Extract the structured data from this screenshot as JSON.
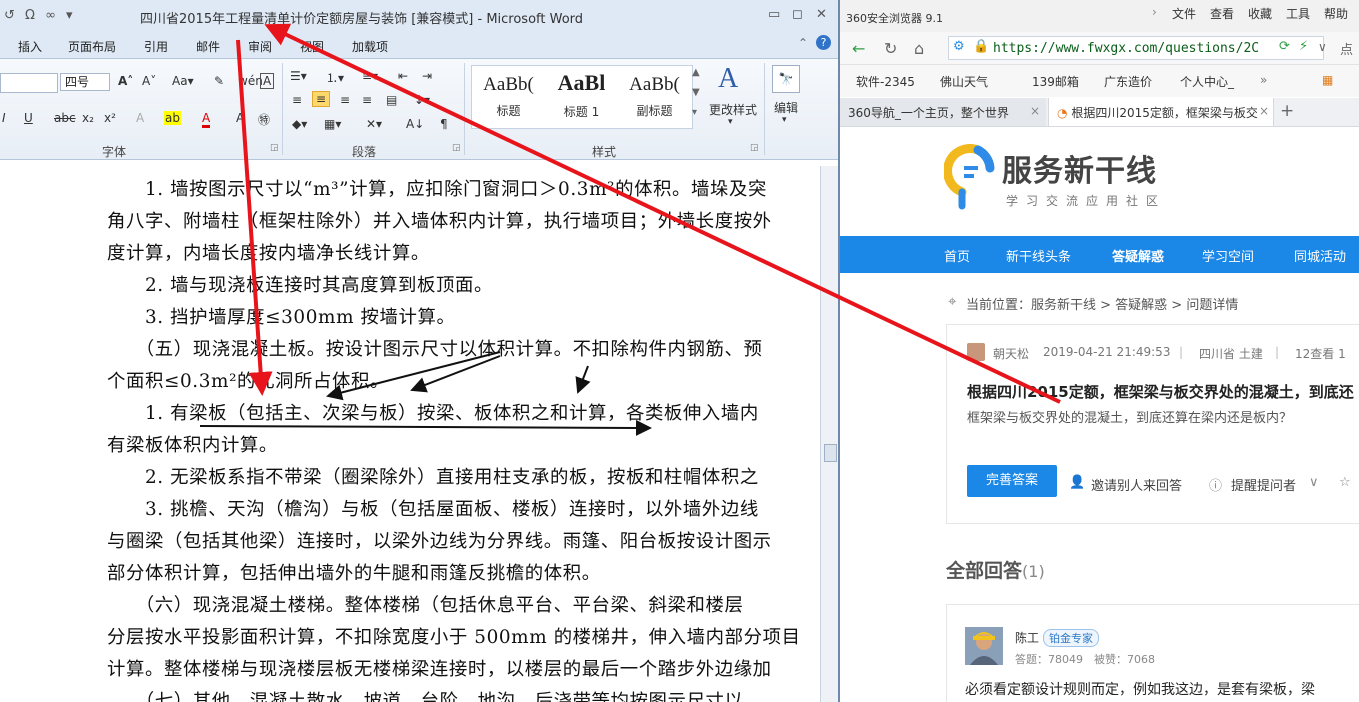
{
  "word": {
    "quick_access": "↺ Ω ∞ ▾",
    "title": "四川省2015年工程量清单计价定额房屋与装饰 [兼容模式] - Microsoft Word",
    "window_controls": {
      "minimize": "▭",
      "restore": "◻",
      "close": "✕"
    },
    "tabs": [
      "插入",
      "页面布局",
      "引用",
      "邮件",
      "审阅",
      "视图",
      "加载项"
    ],
    "font_size": "四号",
    "groups": {
      "font": "字体",
      "paragraph": "段落",
      "styles": "样式"
    },
    "styles": [
      {
        "preview": "AaBb(",
        "name": "标题"
      },
      {
        "preview": "AaBl",
        "name": "标题 1"
      },
      {
        "preview": "AaBb(",
        "name": "副标题"
      }
    ],
    "change_styles": "更改样式",
    "edit": "编辑",
    "document_lines": [
      "　　1. 墙按图示尺寸以“m³”计算，应扣除门窗洞口＞0.3m²的体积。墙垛及突",
      "角八字、附墙柱（框架柱除外）并入墙体积内计算，执行墙项目；外墙长度按外",
      "度计算，内墙长度按内墙净长线计算。",
      "　　2. 墙与现浇板连接时其高度算到板顶面。",
      "　　3. 挡护墙厚度≤300mm 按墙计算。",
      "　　（五）现浇混凝土板。按设计图示尺寸以体积计算。不扣除构件内钢筋、预",
      "个面积≤0.3m²的孔洞所占体积。",
      "　　1. 有梁板（包括主、次梁与板）按梁、板体积之和计算，各类板伸入墙内",
      "有梁板体积内计算。",
      "　　2. 无梁板系指不带梁（圈梁除外）直接用柱支承的板，按板和柱帽体积之",
      "　　3. 挑檐、天沟（檐沟）与板（包括屋面板、楼板）连接时，以外墙外边线",
      "与圈梁（包括其他梁）连接时，以梁外边线为分界线。雨篷、阳台板按设计图示",
      "部分体积计算，包括伸出墙外的牛腿和雨篷反挑檐的体积。",
      "　　（六）现浇混凝土楼梯。整体楼梯（包括休息平台、平台梁、斜梁和楼层",
      "分层按水平投影面积计算，不扣除宽度小于 500mm 的楼梯井，伸入墙内部分项目",
      "计算。整体楼梯与现浇楼层板无楼梯梁连接时，以楼层的最后一个踏步外边缘加",
      "　　（七）其他。混凝土散水、坡道、台阶、地沟、后浇带等均按图示尺寸以"
    ]
  },
  "browser": {
    "app_name": "360安全浏览器 9.1",
    "menu": [
      "文件",
      "查看",
      "收藏",
      "工具",
      "帮助"
    ],
    "url": "https://www.fwxgx.com/questions/2C",
    "addr_right": "点",
    "favorites": [
      "软件-2345",
      "佛山天气",
      "139邮箱",
      "广东造价",
      "个人中心_"
    ],
    "tabs": [
      "360导航_一个主页，整个世界",
      "根据四川2015定额，框架梁与板交"
    ],
    "new_tab": "+",
    "site": {
      "name": "服务新干线",
      "slogan": "学习交流应用社区",
      "nav": [
        "首页",
        "新干线头条",
        "答疑解惑",
        "学习空间",
        "同城活动"
      ],
      "breadcrumb": "当前位置：服务新干线 > 答疑解惑 > 问题详情",
      "question": {
        "author": "朝天松",
        "date": "2019-04-21 21:49:53",
        "tags": "四川省 土建",
        "views": "12查看 1",
        "title": "根据四川2015定额，框架梁与板交界处的混凝土，到底还",
        "summary": "框架梁与板交界处的混凝土，到底还算在梁内还是板内？",
        "answer_button": "完善答案",
        "invite": "邀请别人来回答",
        "remind": "提醒提问者"
      },
      "all_answers": "全部回答",
      "answer_count": "(1)",
      "answer": {
        "user": "陈工",
        "badge": "铂金专家",
        "stats": "答题：78049　被赞：7068",
        "text": "必须看定额设计规则而定，例如我这边，是套有梁板，梁"
      }
    }
  },
  "colors": {
    "word_chrome": "#dfe9f5",
    "site_blue": "#1b87e6",
    "annotation_red": "#e8141b"
  }
}
